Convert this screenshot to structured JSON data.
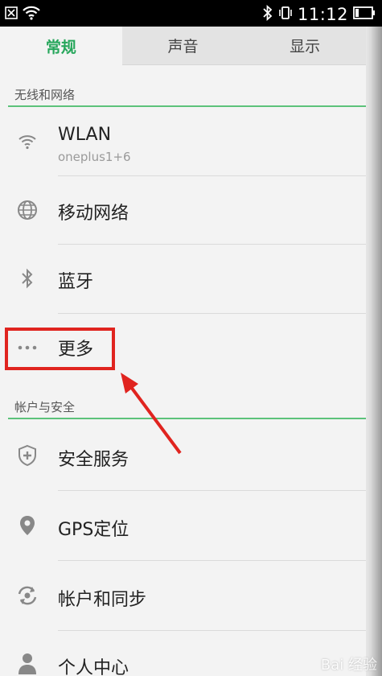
{
  "status_bar": {
    "time": "11:12",
    "icons": [
      "close-box-icon",
      "wifi-icon",
      "bluetooth-icon",
      "vibrate-icon",
      "battery-icon"
    ]
  },
  "tabs": [
    {
      "label": "常规",
      "active": true
    },
    {
      "label": "声音",
      "active": false
    },
    {
      "label": "显示",
      "active": false
    }
  ],
  "sections": {
    "wireless": {
      "label": "无线和网络"
    },
    "account": {
      "label": "帐户与安全"
    }
  },
  "rows": {
    "wlan": {
      "title": "WLAN",
      "subtitle": "oneplus1+6",
      "icon": "wifi-icon"
    },
    "mobile": {
      "title": "移动网络",
      "icon": "globe-icon"
    },
    "bluetooth": {
      "title": "蓝牙",
      "icon": "bluetooth-icon"
    },
    "more": {
      "title": "更多",
      "icon": "more-dots-icon"
    },
    "security": {
      "title": "安全服务",
      "icon": "shield-plus-icon"
    },
    "gps": {
      "title": "GPS定位",
      "icon": "location-pin-icon"
    },
    "sync": {
      "title": "帐户和同步",
      "icon": "sync-icon"
    },
    "personal": {
      "title": "个人中心",
      "icon": "person-icon"
    }
  },
  "colors": {
    "accent_green": "#26a65b",
    "section_line": "#5cc27a",
    "annotation_red": "#e0241f"
  },
  "watermark": {
    "text": "Bai 经验"
  }
}
